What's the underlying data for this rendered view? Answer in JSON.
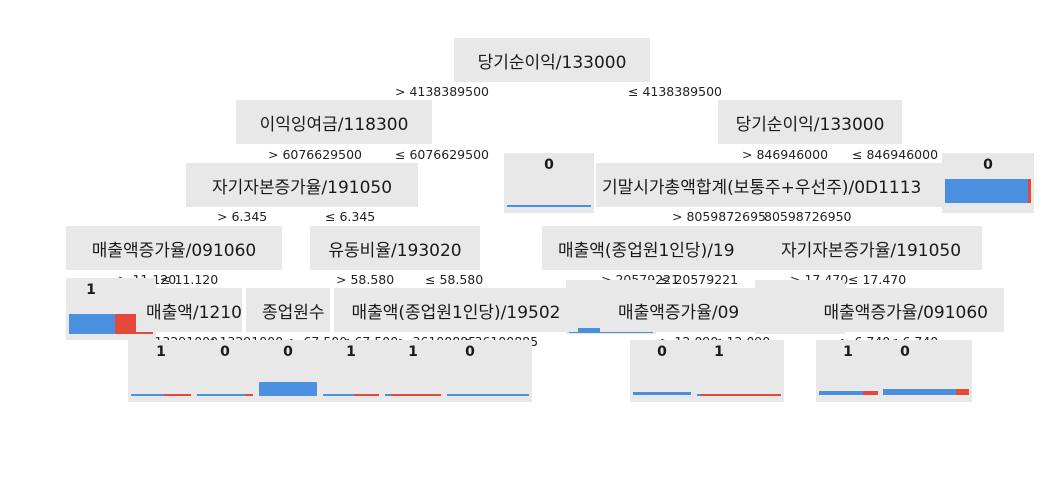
{
  "colors": {
    "node_bg": "#e8e8e8",
    "class0": "#4a8fe0",
    "class1": "#e2493b"
  },
  "nodes": {
    "root": "당기순이익/133000",
    "l1": "이익잉여금/118300",
    "r1": "당기순이익/133000",
    "l2": "자기자본증가율/191050",
    "r2": "기말시가총액합계(보통주+우선주)/0D1113",
    "l3a": "매출액증가율/091060",
    "l3b": "유동비율/193020",
    "r3a": "매출액(종업원1인당)/19",
    "r3b": "자기자본증가율/191050",
    "l4a": "매출액/1210",
    "l4b": "종업원수",
    "l4c": "매출액(종업원1인당)/19502",
    "r4a": "매출액증가율/09",
    "r4b": "매출액증가율/091060"
  },
  "edges": {
    "root_l": "> 4138389500",
    "root_r": "≤ 4138389500",
    "l1_l": "> 6076629500",
    "l1_r": "≤ 6076629500",
    "r1_l": "> 846946000",
    "r1_r": "≤ 846946000",
    "l2_l": "> 6.345",
    "l2_r": "≤ 6.345",
    "r2_l": "> 8059872695",
    "r2_r": "≤ 8059872695",
    "r2_r_shown": "80598726950",
    "l3a_l": "> 11.120",
    "l3a_r": "≤ 11.120",
    "l3b_l": "> 58.580",
    "l3b_r": "≤ 58.580",
    "r3a_l": "> 20579221",
    "r3a_r": "≤ 20579221",
    "r3b_l": "> 17.470",
    "r3b_r": "≤ 17.470",
    "l4a_l": "> 13291000",
    "l4a_r": "≤ 13291000",
    "l4b_l": "> 67.500",
    "l4b_r": "≤ 67.500",
    "l4c_l": "> 36100885",
    "l4c_r": "≤ 36100885",
    "r4a_l": "> 12.090",
    "r4a_r": "≤ 12.090",
    "r4b_l": "> 6.740",
    "r4b_r": "≤ 6.740"
  },
  "leaves": {
    "a": {
      "label": "0",
      "class0": 1.0,
      "class1": 0.0
    },
    "b": {
      "label": "0",
      "class0": 0.97,
      "class1": 0.03
    },
    "c": {
      "label": "1",
      "class0": 0.55,
      "class1": 0.45
    },
    "d": {
      "label": "",
      "class0": 1.0,
      "class1": 0.0
    },
    "e": {
      "label": "",
      "class0": 1.0,
      "class1": 0.0
    },
    "f": {
      "label": "1",
      "class0": 0.55,
      "class1": 0.45
    },
    "g": {
      "label": "0",
      "class0": 0.85,
      "class1": 0.15
    },
    "h": {
      "label": "0",
      "class0": 1.0,
      "class1": 0.0
    },
    "i": {
      "label": "1",
      "class0": 0.55,
      "class1": 0.45
    },
    "j": {
      "label": "1",
      "class0": 0.1,
      "class1": 0.9
    },
    "k": {
      "label": "0",
      "class0": 1.0,
      "class1": 0.0
    },
    "m": {
      "label": "0",
      "class0": 1.0,
      "class1": 0.0
    },
    "n": {
      "label": "1",
      "class0": 0.05,
      "class1": 0.95
    },
    "o": {
      "label": "1",
      "class0": 0.75,
      "class1": 0.25
    },
    "p": {
      "label": "0",
      "class0": 0.85,
      "class1": 0.15
    }
  }
}
